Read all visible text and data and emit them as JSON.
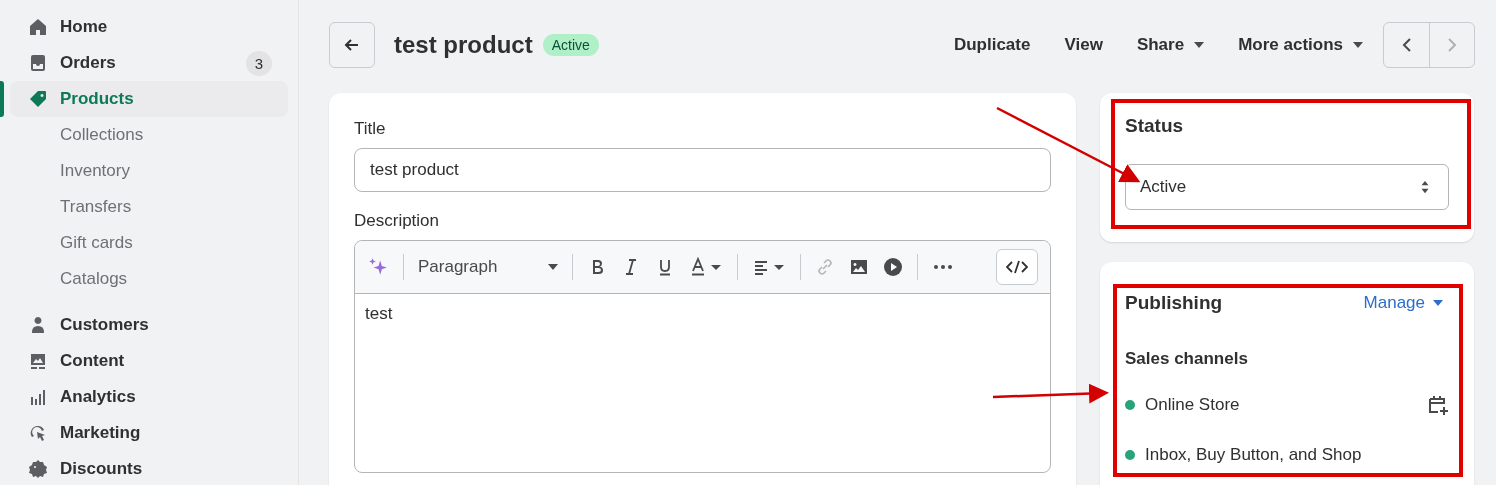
{
  "sidebar": {
    "items": [
      {
        "label": "Home",
        "kind": "main",
        "selected": false
      },
      {
        "label": "Orders",
        "kind": "main",
        "selected": false,
        "badge": "3"
      },
      {
        "label": "Products",
        "kind": "main",
        "selected": true
      },
      {
        "label": "Collections",
        "kind": "sub",
        "selected": false
      },
      {
        "label": "Inventory",
        "kind": "sub",
        "selected": false
      },
      {
        "label": "Transfers",
        "kind": "sub",
        "selected": false
      },
      {
        "label": "Gift cards",
        "kind": "sub",
        "selected": false
      },
      {
        "label": "Catalogs",
        "kind": "sub",
        "selected": false
      },
      {
        "label": "Customers",
        "kind": "main",
        "selected": false
      },
      {
        "label": "Content",
        "kind": "main",
        "selected": false
      },
      {
        "label": "Analytics",
        "kind": "main",
        "selected": false
      },
      {
        "label": "Marketing",
        "kind": "main",
        "selected": false
      },
      {
        "label": "Discounts",
        "kind": "main",
        "selected": false
      }
    ]
  },
  "header": {
    "title": "test product",
    "badge": "Active",
    "actions": [
      {
        "label": "Duplicate",
        "dropdown": false
      },
      {
        "label": "View",
        "dropdown": false
      },
      {
        "label": "Share",
        "dropdown": true
      },
      {
        "label": "More actions",
        "dropdown": true
      }
    ]
  },
  "form": {
    "title_label": "Title",
    "title_value": "test product",
    "description_label": "Description",
    "paragraph_style": "Paragraph",
    "description_value": "test"
  },
  "status": {
    "heading": "Status",
    "value": "Active"
  },
  "publishing": {
    "heading": "Publishing",
    "manage": "Manage",
    "subheading": "Sales channels",
    "channels": [
      {
        "name": "Online Store",
        "color": "#29a37a",
        "schedule": true
      },
      {
        "name": "Inbox, Buy Button, and Shop",
        "color": "#29a37a",
        "schedule": false
      }
    ]
  }
}
